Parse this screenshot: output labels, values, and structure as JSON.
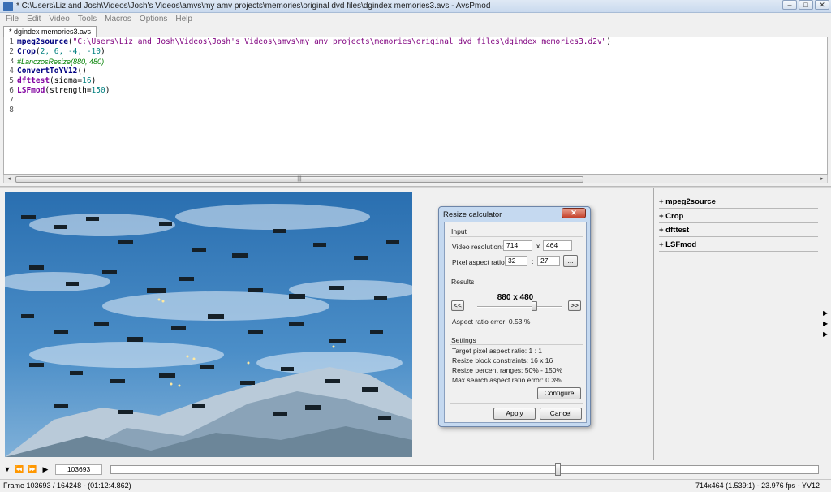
{
  "window": {
    "title": "* C:\\Users\\Liz and Josh\\Videos\\Josh's Videos\\amvs\\my amv projects\\memories\\original dvd files\\dgindex memories3.avs - AvsPmod",
    "minimize": "–",
    "maximize": "□",
    "close": "✕"
  },
  "menu": [
    "File",
    "Edit",
    "Video",
    "Tools",
    "Macros",
    "Options",
    "Help"
  ],
  "tab": {
    "label": "* dgindex memories3.avs"
  },
  "editor": {
    "line_numbers": [
      "1",
      "2",
      "3",
      "4",
      "5",
      "6",
      "7",
      "8"
    ],
    "lines": [
      {
        "fn": "mpeg2source",
        "open": "(",
        "str": "\"C:\\Users\\Liz and Josh\\Videos\\Josh's Videos\\amvs\\my amv projects\\memories\\original dvd files\\dgindex memories3.d2v\"",
        "close": ")"
      },
      {
        "fn": "Crop",
        "open": "(",
        "args": "2, 6, -4, -10",
        "close": ")"
      },
      {
        "comment": "#LanczosResize(880, 480)"
      },
      {
        "fn": "ConvertToYV12",
        "args": "()"
      },
      {
        "fn": "dfttest",
        "open": "(",
        "param": "sigma=",
        "num": "16",
        "close": ")"
      },
      {
        "fn": "LSFmod",
        "open": "(",
        "param": "strength=",
        "num": "150",
        "close": ")"
      }
    ],
    "scroll_grip": "|||"
  },
  "filters": [
    {
      "label": "+ mpeg2source"
    },
    {
      "label": "+ Crop"
    },
    {
      "label": "+ dfttest"
    },
    {
      "label": "+ LSFmod"
    }
  ],
  "dialog": {
    "title": "Resize calculator",
    "close": "✕",
    "input_label": "Input",
    "video_resolution_label": "Video resolution:",
    "video_width": "714",
    "x_sep": "x",
    "video_height": "464",
    "pixel_aspect_label": "Pixel aspect ratio:",
    "par_num": "32",
    "colon_sep": ":",
    "par_den": "27",
    "browse": "...",
    "results_label": "Results",
    "result_size": "880 x 480",
    "prev": "<<",
    "next": ">>",
    "aspect_error": "Aspect ratio error:  0.53 %",
    "settings_label": "Settings",
    "settings": [
      "Target pixel aspect ratio:  1 : 1",
      "Resize block constraints:  16 x 16",
      "Resize percent ranges:  50% - 150%",
      "Max search aspect ratio error:  0.3%"
    ],
    "configure": "Configure",
    "apply": "Apply",
    "cancel": "Cancel"
  },
  "timeline": {
    "frame": "103693",
    "position_fraction": 0.631
  },
  "status": {
    "left": "Frame 103693 / 164248  -  (01:12:4.862)",
    "right": "714x464 (1.539:1)  -  23.976 fps  -  YV12"
  }
}
